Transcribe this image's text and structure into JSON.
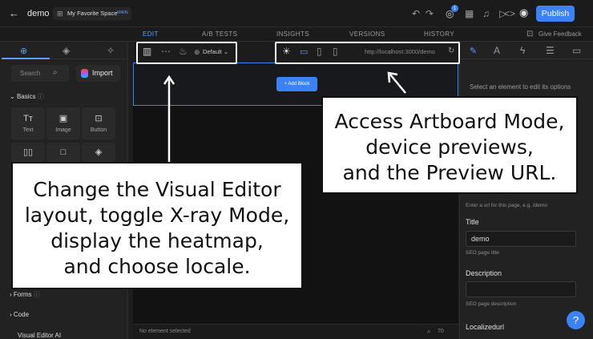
{
  "topbar": {
    "project": "demo",
    "space": "My Favorite Space",
    "branch": "MAIN",
    "notification_count": "1",
    "publish_label": "Publish"
  },
  "tabs": [
    "EDIT",
    "A/B TESTS",
    "INSIGHTS",
    "VERSIONS",
    "HISTORY"
  ],
  "feedback_label": "Give Feedback",
  "left": {
    "search_placeholder": "Search",
    "import_label": "Import",
    "section_basics": "Basics",
    "blocks": [
      "Text",
      "Image",
      "Button"
    ],
    "section_forms": "Forms",
    "section_code": "Code",
    "section_ai": "Visual Editor AI"
  },
  "canvas_toolbar": {
    "locale": "Default",
    "preview_url": "http://localhost:3000/demo"
  },
  "canvas": {
    "add_block_label": "+ Add Block",
    "status_text": "No element selected",
    "zoom": "70"
  },
  "right": {
    "hint": "Select an element to edit its options",
    "url_help": "Enter a url for this page, e.g. /demo",
    "title_label": "Title",
    "title_value": "demo",
    "title_help": "SEO page title",
    "description_label": "Description",
    "description_help": "SEO page description",
    "localized_label": "Localizedurl"
  },
  "callouts": {
    "left": [
      "Change the Visual Editor",
      "layout, toggle X-ray Mode,",
      "display the heatmap,",
      "and choose locale."
    ],
    "right": [
      "Access Artboard Mode,",
      "device previews,",
      "and the Preview URL."
    ]
  },
  "icons": [
    "back-arrow-icon",
    "space-icon",
    "undo-icon",
    "redo-icon",
    "notification-icon",
    "calendar-icon",
    "bell-icon",
    "play-icon",
    "code-icon",
    "eye-icon",
    "layout-icon",
    "xray-icon",
    "heatmap-icon",
    "globe-icon",
    "artboard-icon",
    "desktop-icon",
    "tablet-icon",
    "mobile-icon",
    "refresh-icon",
    "help-icon"
  ]
}
